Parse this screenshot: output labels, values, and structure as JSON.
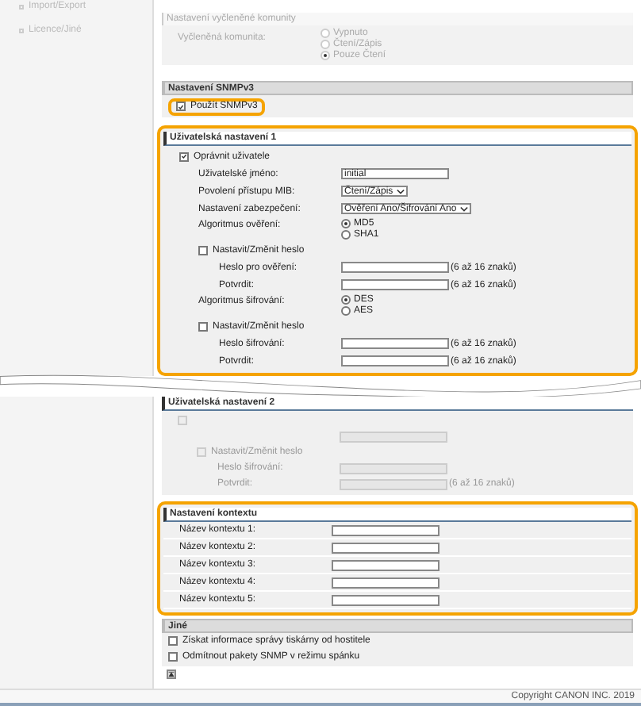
{
  "sidebar": {
    "items": [
      {
        "label": "Import/Export"
      },
      {
        "label": "Licence/Jiné"
      }
    ]
  },
  "dedicated_community": {
    "title": "Nastavení vyčleněné komunity",
    "label": "Vyčleněná komunita:",
    "options": [
      {
        "label": "Vypnuto",
        "selected": false
      },
      {
        "label": "Čtení/Zápis",
        "selected": false
      },
      {
        "label": "Pouze Čtení",
        "selected": true
      }
    ]
  },
  "snmpv3": {
    "title": "Nastavení SNMPv3",
    "use": {
      "label": "Použít SNMPv3",
      "checked": true,
      "highlighted": true
    }
  },
  "user_settings_1": {
    "title": "Uživatelská nastavení 1",
    "highlighted": true,
    "disabled": false,
    "rows": [
      {
        "kind": "checkbox",
        "label": "Oprávnit uživatele",
        "checked": true,
        "children": [
          {
            "kind": "text",
            "label": "Uživatelské jméno:",
            "value": "initial"
          },
          {
            "kind": "select",
            "label": "Povolení přístupu MIB:",
            "value": "Čtení/Zápis"
          },
          {
            "kind": "select",
            "label": "Nastavení zabezpečení:",
            "value": "Ověření Ano/Šifrování Ano"
          },
          {
            "kind": "radio",
            "label": "Algoritmus ověření:",
            "options": [
              {
                "label": "MD5",
                "selected": true
              },
              {
                "label": "SHA1",
                "selected": false
              }
            ]
          },
          {
            "kind": "checkbox",
            "label": "Nastavit/Změnit heslo",
            "checked": false,
            "children": [
              {
                "kind": "password",
                "label": "Heslo pro ověření:",
                "hint": "(6 až 16 znaků)"
              },
              {
                "kind": "password",
                "label": "Potvrdit:",
                "hint": "(6 až 16 znaků)"
              }
            ]
          },
          {
            "kind": "radio",
            "label": "Algoritmus šifrování:",
            "options": [
              {
                "label": "DES",
                "selected": true
              },
              {
                "label": "AES",
                "selected": false
              }
            ]
          },
          {
            "kind": "checkbox",
            "label": "Nastavit/Změnit heslo",
            "checked": false,
            "children": [
              {
                "kind": "password",
                "label": "Heslo šifrování:",
                "hint": "(6 až 16 znaků)"
              },
              {
                "kind": "password",
                "label": "Potvrdit:",
                "hint": "(6 až 16 znaků)"
              }
            ]
          }
        ]
      }
    ]
  },
  "user_settings_2": {
    "title": "Uživatelská nastavení 2",
    "highlighted": false,
    "disabled": true,
    "rows": [
      {
        "kind": "checkbox",
        "label": "",
        "checked": false,
        "children": [
          {
            "kind": "password"
          },
          {
            "kind": "checkbox",
            "label": "Nastavit/Změnit heslo",
            "checked": false,
            "children": [
              {
                "kind": "password",
                "label": "Heslo šifrování:"
              },
              {
                "kind": "password",
                "label": "Potvrdit:",
                "hint": "(6 až 16 znaků)"
              }
            ]
          }
        ]
      }
    ]
  },
  "context_settings": {
    "title": "Nastavení kontextu",
    "highlighted": true,
    "fields": [
      {
        "label": "Název kontextu 1:"
      },
      {
        "label": "Název kontextu 2:"
      },
      {
        "label": "Název kontextu 3:"
      },
      {
        "label": "Název kontextu 4:"
      },
      {
        "label": "Název kontextu 5:"
      }
    ]
  },
  "other": {
    "title": "Jiné",
    "options": [
      {
        "label": "Získat informace správy tiskárny od hostitele",
        "checked": false
      },
      {
        "label": "Odmítnout pakety SNMP v režimu spánku",
        "checked": false
      }
    ]
  },
  "footer": {
    "copyright": "Copyright CANON INC. 2019"
  }
}
